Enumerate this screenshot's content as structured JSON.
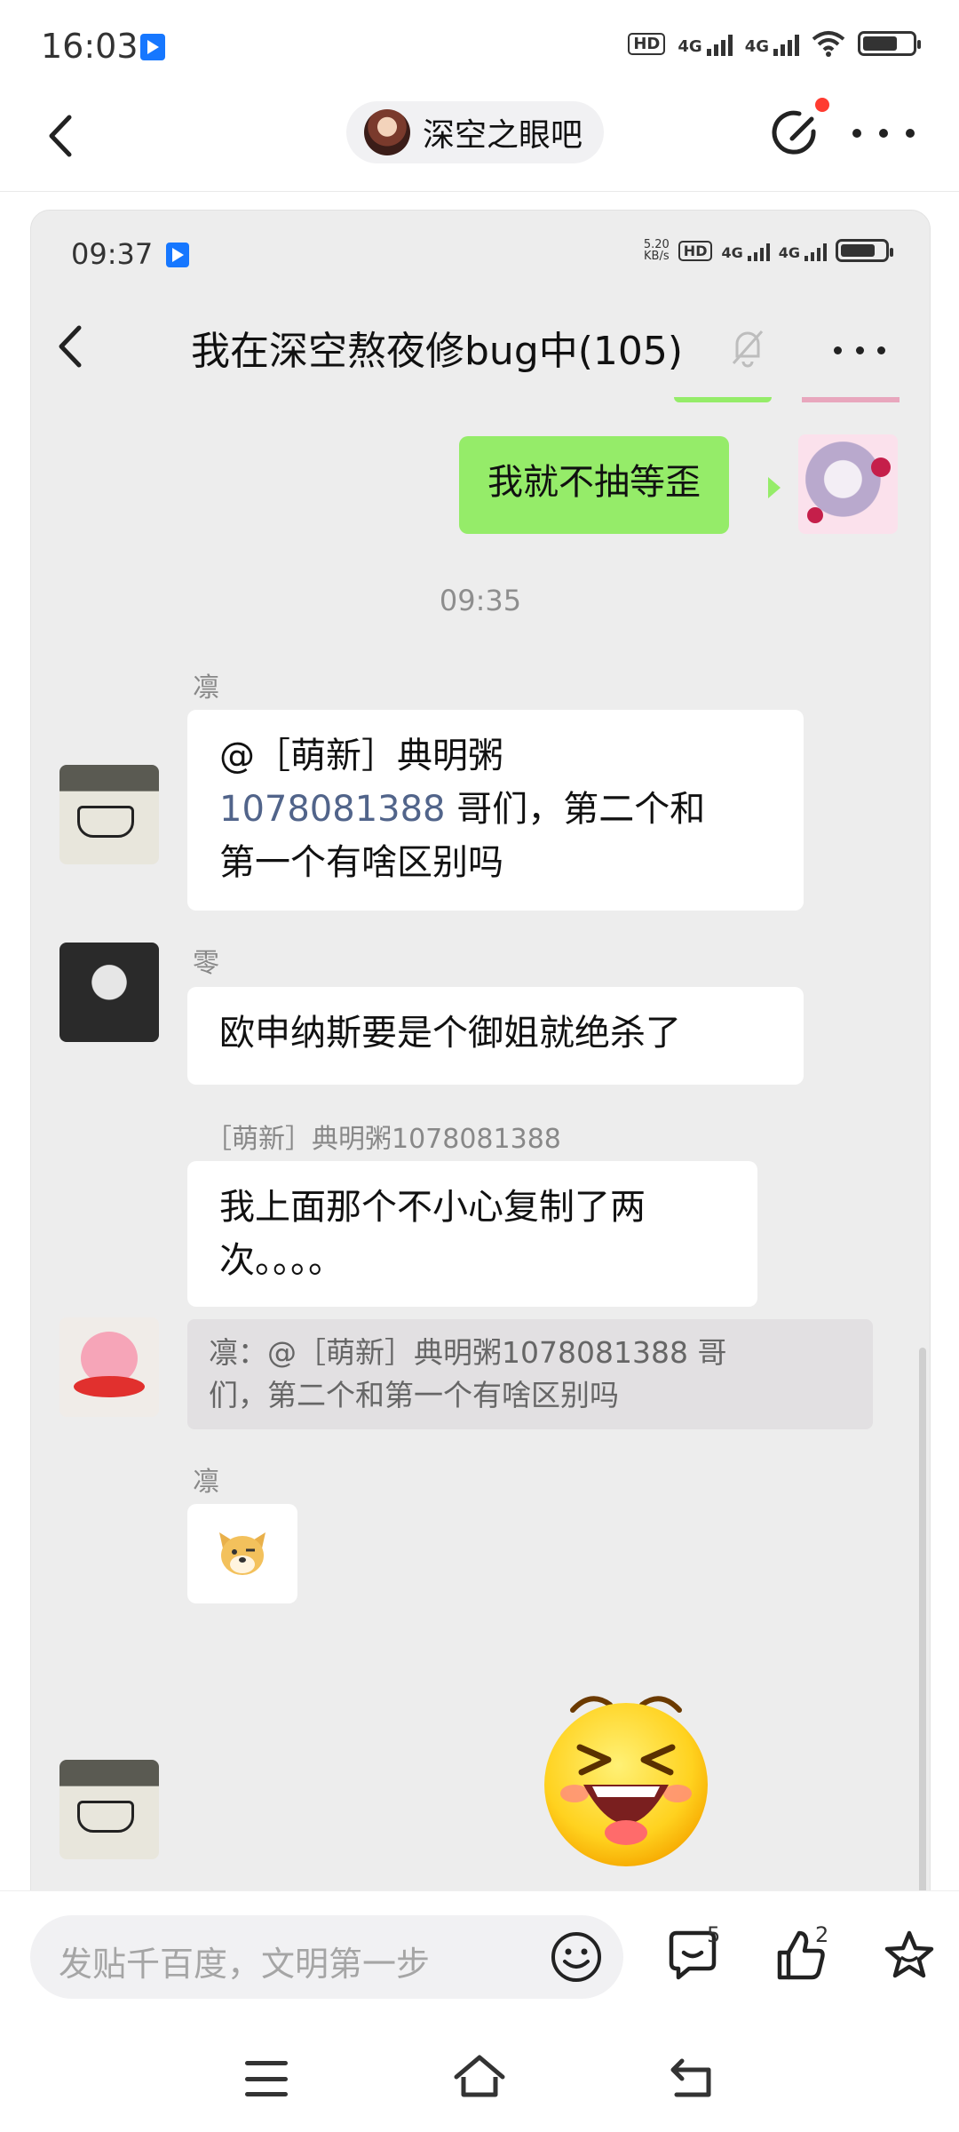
{
  "status_bar": {
    "time": "16:03",
    "signal1": "4G",
    "signal2": "4G",
    "battery_level": 0.7
  },
  "header": {
    "forum_name": "深空之眼吧"
  },
  "screenshot": {
    "status": {
      "time": "09:37",
      "speed": "5.20",
      "speed_unit": "KB/s",
      "signal1": "4G",
      "signal2": "4G",
      "battery_level": 0.8
    },
    "chat_title": "我在深空熬夜修bug中(105)",
    "messages": {
      "m1_text": "我就不抽等歪",
      "timestamp": "09:35",
      "m2_name": "凛",
      "m2_line1": "@［萌新］典明粥",
      "m2_number": "1078081388",
      "m2_line2_rest": " 哥们，第二个和",
      "m2_line3": "第一个有啥区别吗",
      "m3_name": "零",
      "m3_text": "欧申纳斯要是个御姐就绝杀了",
      "m4_name": "［萌新］典明粥1078081388",
      "m4_line1": "我上面那个不小心复制了两",
      "m4_line2": "次。。。。",
      "m4_quote_line1": "凛：@［萌新］典明粥1078081388 哥",
      "m4_quote_line2": "们，第二个和第一个有啥区别吗",
      "m5_name": "凛"
    }
  },
  "bottom_bar": {
    "input_placeholder": "发贴千百度，文明第一步",
    "comment_count": "5",
    "like_count": "2"
  }
}
